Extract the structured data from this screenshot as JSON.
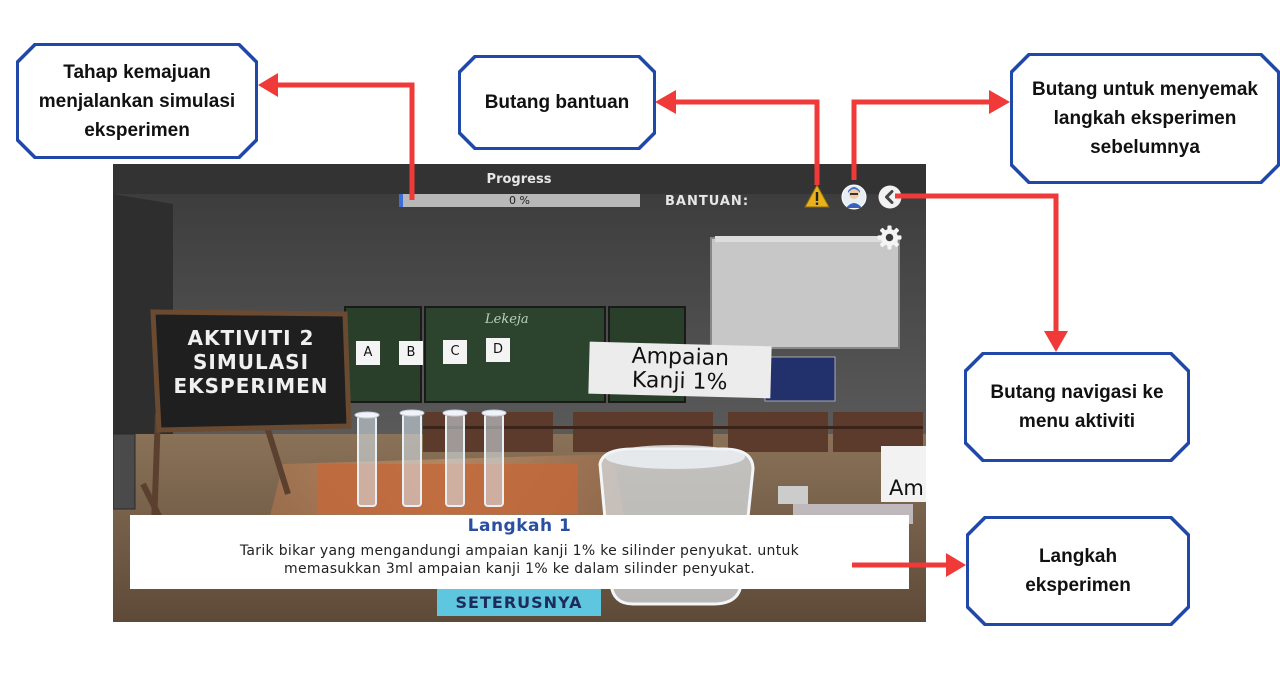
{
  "callouts": {
    "progress": "Tahap  kemajuan menjalankan simulasi eksperimen",
    "help": "Butang bantuan",
    "review": "Butang untuk menyemak langkah eksperimen sebelumnya",
    "nav": "Butang navigasi ke menu aktiviti",
    "step": "Langkah eksperimen"
  },
  "hud": {
    "progress_label": "Progress",
    "progress_value": "0 %",
    "progress_fraction": 0.0,
    "help_label": "BANTUAN:"
  },
  "scene": {
    "board_sign": [
      "AKTIVITI 2",
      "SIMULASI",
      "EKSPERIMEN"
    ],
    "chalk_text": "Lekeja",
    "labels": [
      "A",
      "B",
      "C",
      "D"
    ],
    "sign_title": [
      "Ampaian",
      "Kanji 1%"
    ],
    "side_sign": "Am"
  },
  "instruction": {
    "title": "Langkah 1",
    "line1": "Tarik bikar yang mengandungi ampaian kanji 1% ke silinder penyukat. untuk",
    "line2": "memasukkan 3ml ampaian kanji 1% ke dalam silinder penyukat.",
    "next_button": "SETERUSNYA"
  },
  "colors": {
    "callout_border": "#1f48a8",
    "arrow": "#f03a3a",
    "title_blue": "#2a4fa0",
    "next_button_bg": "#5fc6e0"
  },
  "icons": [
    "warning-icon",
    "scientist-avatar-icon",
    "back-arrow-icon",
    "settings-gear-icon"
  ]
}
